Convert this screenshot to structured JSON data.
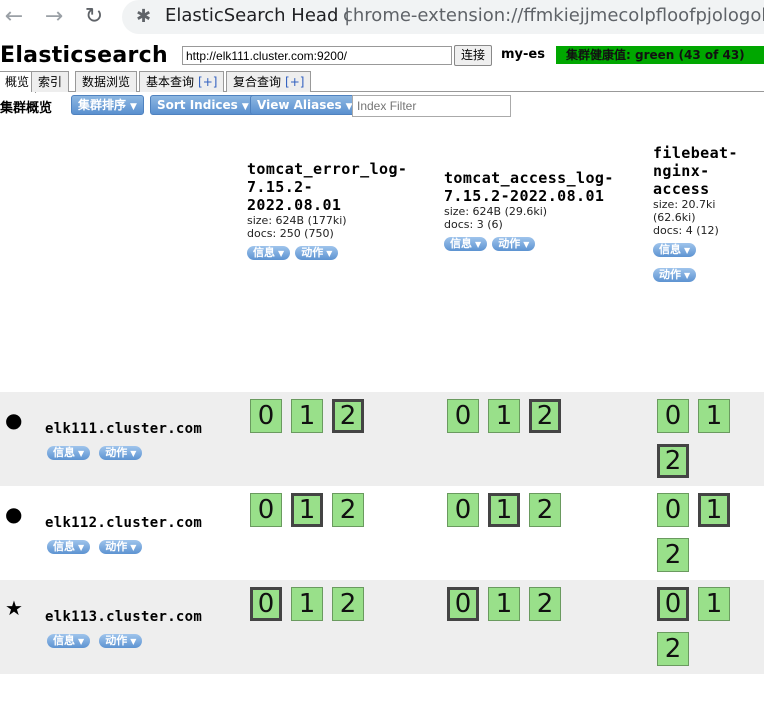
{
  "browser": {
    "tab_title": "ElasticSearch Head",
    "separator": "|",
    "url": "chrome-extension://ffmkiejjmecolpfloofpjologoblk"
  },
  "header": {
    "app_title": "Elasticsearch",
    "connect_url": "http://elk111.cluster.com:9200/",
    "connect_label": "连接",
    "cluster_name": "my-es",
    "health": "集群健康值: green (43 of 43)",
    "health_color": "#00a700"
  },
  "tabs": [
    {
      "label": "概览",
      "active": true
    },
    {
      "label": "索引"
    },
    {
      "label": "数据浏览"
    },
    {
      "label": "基本查询",
      "plus": "[+]"
    },
    {
      "label": "复合查询",
      "plus": "[+]"
    }
  ],
  "toolbar": {
    "title": "集群概览",
    "sort_cluster": "集群排序",
    "sort_indices": "Sort Indices",
    "view_aliases": "View Aliases",
    "filter_placeholder": "Index Filter"
  },
  "pill_labels": {
    "info": "信息",
    "action": "动作"
  },
  "indices": [
    {
      "name_lines": [
        "tomcat_error_log-",
        "7.15.2-",
        "2022.08.01"
      ],
      "size": "size: 624B (177ki)",
      "docs": "docs: 250 (750)"
    },
    {
      "name_lines": [
        "tomcat_access_log-",
        "7.15.2-2022.08.01"
      ],
      "size": "size: 624B (29.6ki)",
      "docs": "docs: 3 (6)"
    },
    {
      "name_lines": [
        "filebeat-",
        "nginx-",
        "access"
      ],
      "size_lines": [
        "size: 20.7ki",
        "(62.6ki)"
      ],
      "docs": "docs: 4 (12)"
    }
  ],
  "nodes": [
    {
      "name": "elk111.cluster.com",
      "marker": "●",
      "shards": [
        [
          "0",
          "1",
          "2"
        ],
        [
          "0",
          "1",
          "2"
        ],
        [
          "0",
          "1",
          "2"
        ]
      ],
      "primary": [
        [
          "2"
        ],
        [
          "2"
        ],
        [
          "2"
        ]
      ]
    },
    {
      "name": "elk112.cluster.com",
      "marker": "●",
      "shards": [
        [
          "0",
          "1",
          "2"
        ],
        [
          "0",
          "1",
          "2"
        ],
        [
          "0",
          "1",
          "2"
        ]
      ],
      "primary": [
        [
          "1"
        ],
        [
          "1"
        ],
        [
          "1"
        ]
      ]
    },
    {
      "name": "elk113.cluster.com",
      "marker": "★",
      "shards": [
        [
          "0",
          "1",
          "2"
        ],
        [
          "0",
          "1",
          "2"
        ],
        [
          "0",
          "1",
          "2"
        ]
      ],
      "primary": [
        [
          "0"
        ],
        [
          "0"
        ],
        [
          "0"
        ]
      ]
    }
  ]
}
